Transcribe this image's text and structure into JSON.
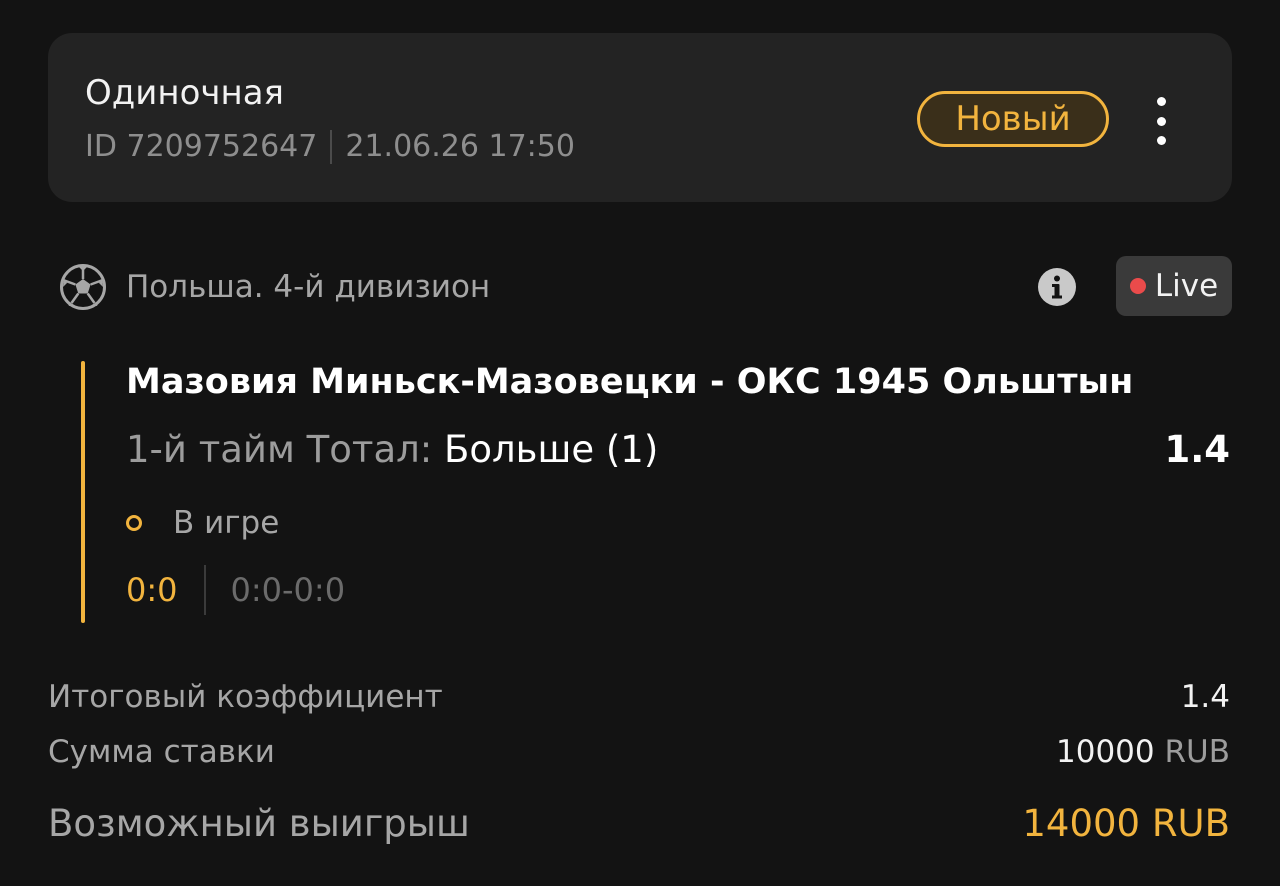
{
  "header": {
    "bet_type": "Одиночная",
    "bet_id": "ID 7209752647",
    "datetime": "21.06.26 17:50",
    "status": "Новый",
    "status_color": "#f2b43e",
    "more_icon": "more-vertical-icon"
  },
  "event": {
    "sport_icon": "soccer-ball-icon",
    "league": "Польша. 4-й дивизион",
    "info_icon": "info-icon",
    "live_label": "Live",
    "live_dot_color": "#ea4b4b",
    "match": "Мазовия Миньск-Мазовецки - ОКС 1945 Ольштын",
    "market_label": "1-й тайм Тотал: ",
    "market_outcome": "Больше (1)",
    "coefficient": "1.4",
    "state": "В игре",
    "score": "0:0",
    "period_scores": "0:0-0:0"
  },
  "summary": {
    "total_coef_label": "Итоговый коэффициент",
    "total_coef_value": "1.4",
    "stake_label": "Сумма ставки",
    "stake_amount": "10000",
    "stake_currency": "RUB",
    "payout_label": "Возможный выигрыш",
    "payout_value": "14000 RUB"
  },
  "colors": {
    "accent": "#f2b43e",
    "background": "#131313",
    "card": "#232323"
  }
}
